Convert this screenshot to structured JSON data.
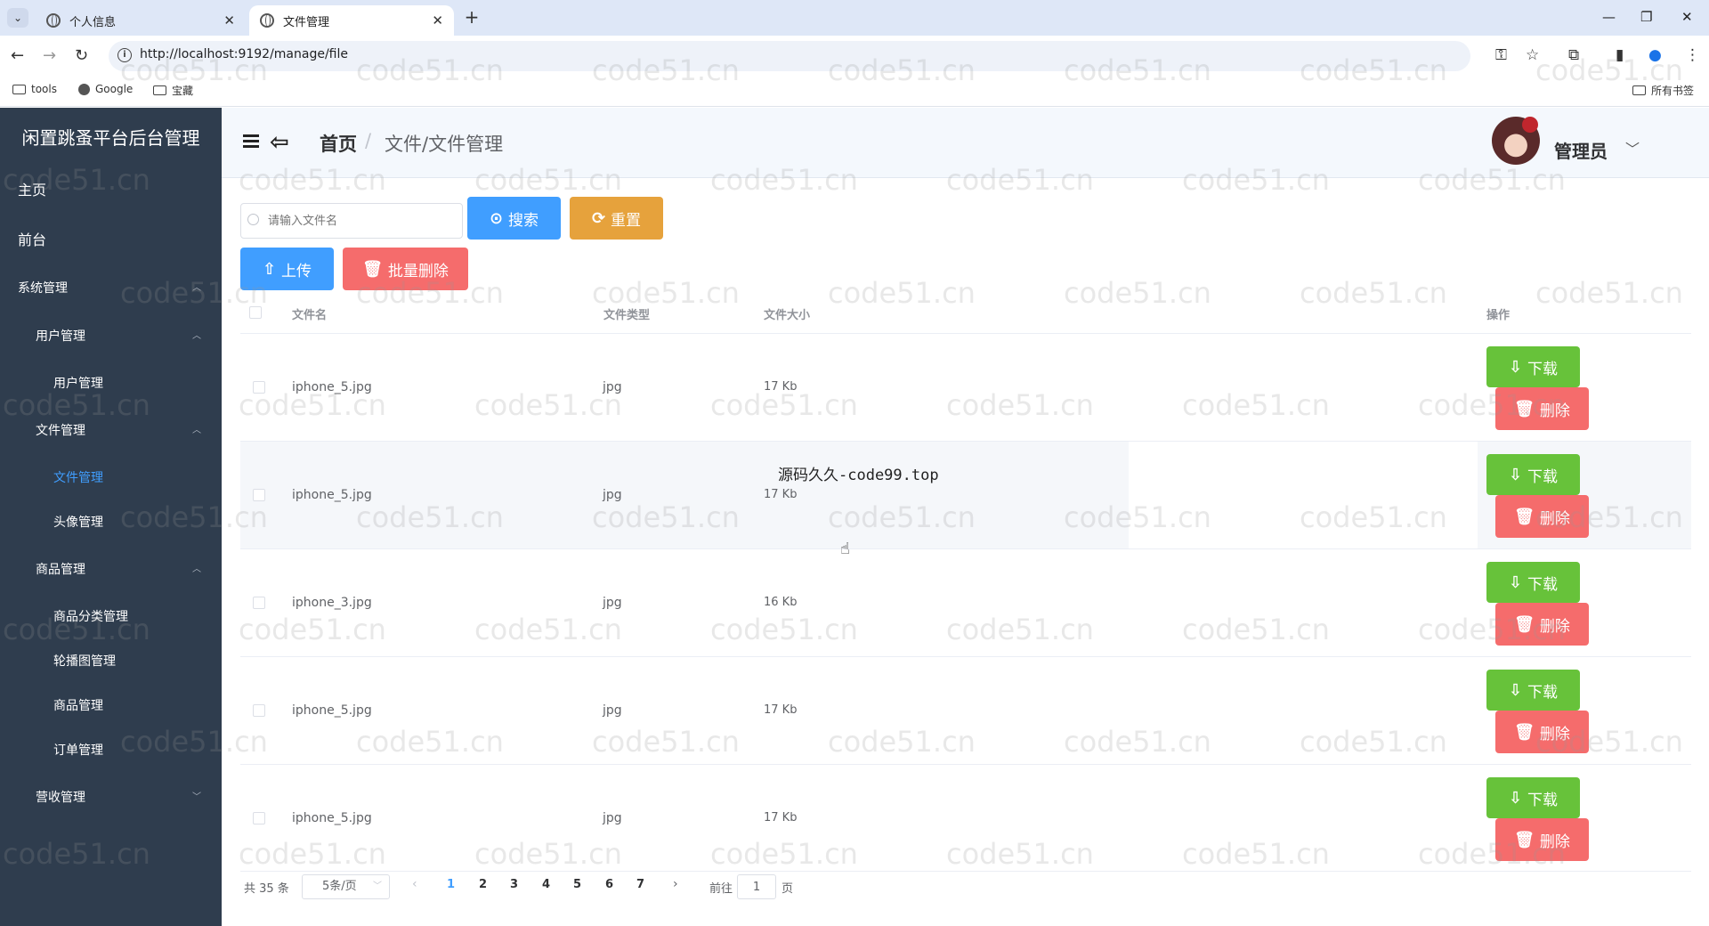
{
  "browser": {
    "tabs": [
      {
        "label": "个人信息",
        "active": false
      },
      {
        "label": "文件管理",
        "active": true
      }
    ],
    "url": "http://localhost:9192/manage/file",
    "bookmarks": [
      {
        "label": "tools",
        "icon": "folder-icon"
      },
      {
        "label": "Google",
        "icon": "google-icon"
      },
      {
        "label": "宝藏",
        "icon": "folder-icon"
      }
    ],
    "all_bookmarks": "所有书签"
  },
  "sidebar": {
    "brand": "闲置跳蚤平台后台管理",
    "items": [
      {
        "label": "主页",
        "level": 0
      },
      {
        "label": "前台",
        "level": 0
      },
      {
        "label": "系统管理",
        "level": 1,
        "expanded": true
      },
      {
        "label": "用户管理",
        "level": 2,
        "expanded": true
      },
      {
        "label": "用户管理",
        "level": 3
      },
      {
        "label": "文件管理",
        "level": 2,
        "expanded": true
      },
      {
        "label": "文件管理",
        "level": 3,
        "active": true
      },
      {
        "label": "头像管理",
        "level": 3
      },
      {
        "label": "商品管理",
        "level": 2,
        "expanded": true
      },
      {
        "label": "商品分类管理",
        "level": 3
      },
      {
        "label": "轮播图管理",
        "level": 3
      },
      {
        "label": "商品管理",
        "level": 3
      },
      {
        "label": "订单管理",
        "level": 3
      },
      {
        "label": "营收管理",
        "level": 2,
        "expanded": false
      }
    ]
  },
  "header": {
    "breadcrumb_home": "首页",
    "breadcrumb_sep": "/",
    "breadcrumb_page": "文件/文件管理",
    "user_name": "管理员"
  },
  "toolbar": {
    "search_placeholder": "请输入文件名",
    "search_label": "搜索",
    "reset_label": "重置",
    "upload_label": "上传",
    "batch_delete_label": "批量删除"
  },
  "table": {
    "columns": [
      "文件名",
      "文件类型",
      "文件大小",
      "操作"
    ],
    "rows": [
      {
        "name": "iphone_5.jpg",
        "type": "jpg",
        "size": "17 Kb"
      },
      {
        "name": "iphone_5.jpg",
        "type": "jpg",
        "size": "17 Kb"
      },
      {
        "name": "iphone_3.jpg",
        "type": "jpg",
        "size": "16 Kb"
      },
      {
        "name": "iphone_5.jpg",
        "type": "jpg",
        "size": "17 Kb"
      },
      {
        "name": "iphone_5.jpg",
        "type": "jpg",
        "size": "17 Kb"
      }
    ],
    "download_label": "下载",
    "delete_label": "删除"
  },
  "pagination": {
    "total": "共 35 条",
    "page_size": "5条/页",
    "pages": [
      "1",
      "2",
      "3",
      "4",
      "5",
      "6",
      "7"
    ],
    "current": "1",
    "goto_label": "前往",
    "goto_value": "1",
    "goto_unit": "页"
  },
  "overlay": {
    "watermark_text": "源码久久-code99.top",
    "repeat_watermark": "code51.cn"
  },
  "colors": {
    "primary": "#409eff",
    "warning": "#e6a23c",
    "danger": "#f56c6c",
    "success": "#67c23a",
    "sidebar_bg": "#2f3d4e"
  }
}
